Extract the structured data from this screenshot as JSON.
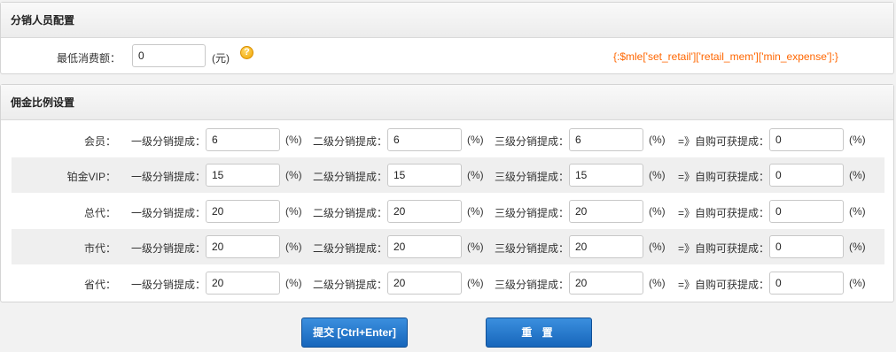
{
  "section_distributor": {
    "title": "分销人员配置",
    "min_expense_label": "最低消费额：",
    "min_expense_value": "0",
    "unit": "(元)",
    "help_icon": "?",
    "template_var": "{:$mle['set_retail']['retail_mem']['min_expense']:}"
  },
  "section_commission": {
    "title": "佣金比例设置",
    "col_labels": {
      "level1": "一级分销提成：",
      "level2": "二级分销提成：",
      "level3": "三级分销提成：",
      "self": "=》自购可获提成："
    },
    "unit": "(%)",
    "rows": [
      {
        "label": "会员：",
        "level1": "6",
        "level2": "6",
        "level3": "6",
        "self": "0"
      },
      {
        "label": "铂金VIP：",
        "level1": "15",
        "level2": "15",
        "level3": "15",
        "self": "0"
      },
      {
        "label": "总代：",
        "level1": "20",
        "level2": "20",
        "level3": "20",
        "self": "0"
      },
      {
        "label": "市代：",
        "level1": "20",
        "level2": "20",
        "level3": "20",
        "self": "0"
      },
      {
        "label": "省代：",
        "level1": "20",
        "level2": "20",
        "level3": "20",
        "self": "0"
      }
    ]
  },
  "buttons": {
    "submit": "提交 [Ctrl+Enter]",
    "reset": "重  置"
  }
}
